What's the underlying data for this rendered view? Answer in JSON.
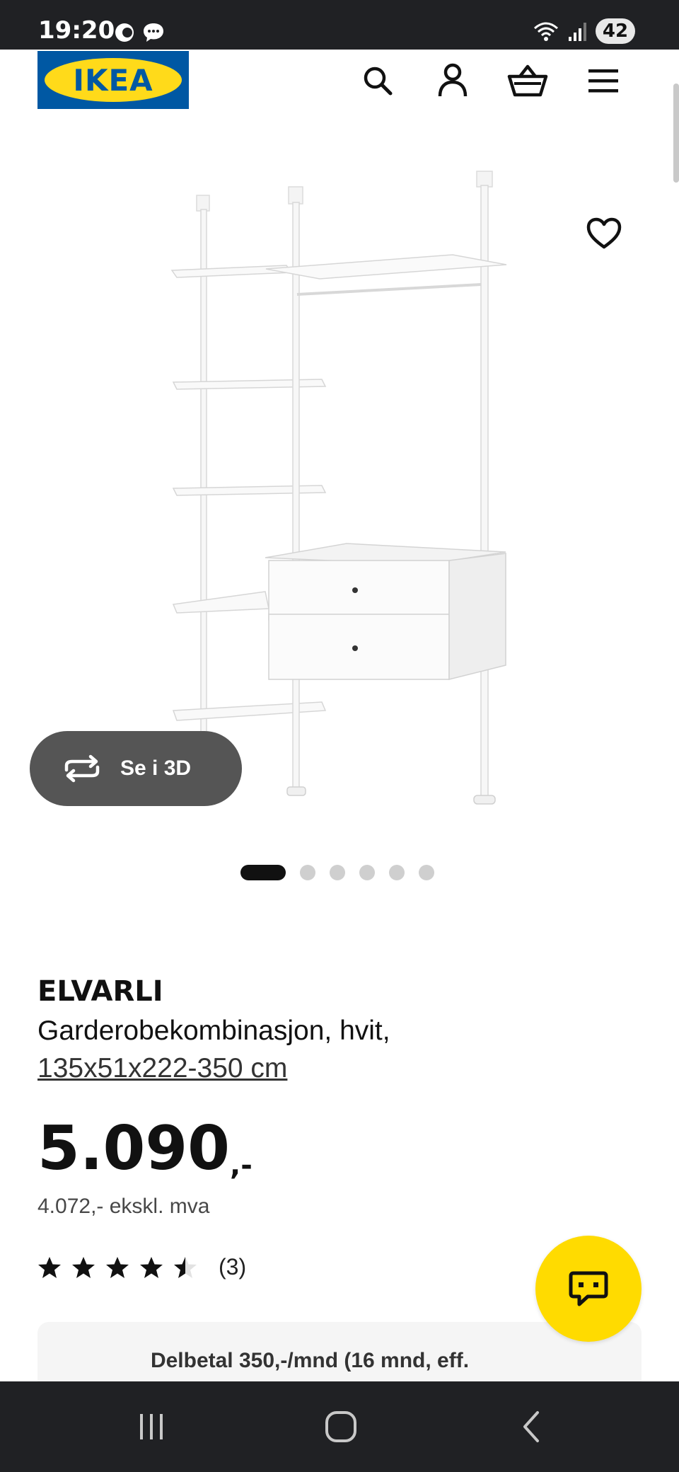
{
  "status_bar": {
    "time": "19:20",
    "battery": "42",
    "icons": [
      "do-not-disturb-icon",
      "chat-bubble-icon",
      "wifi-icon",
      "signal-icon",
      "battery-icon"
    ]
  },
  "header": {
    "logo_text": "IKEA",
    "icons": [
      "search-icon",
      "account-icon",
      "basket-icon",
      "menu-icon"
    ]
  },
  "gallery": {
    "view_3d_label": "Se i 3D",
    "slides": 6,
    "active_slide": 1
  },
  "product": {
    "name": "ELVARLI",
    "description": "Garderobekombinasjon, hvit,",
    "measure": "135x51x222-350 cm",
    "price": "5.090",
    "price_suffix": ",-",
    "price_ex_vat": "4.072,- ekskl. mva",
    "rating_value": 4.5,
    "rating_max": 5,
    "rating_count": "(3)"
  },
  "installment": {
    "text": "Delbetal 350,-/mnd (16 mnd, eff."
  },
  "colors": {
    "ikea_blue": "#0058a3",
    "ikea_yellow": "#ffda1a",
    "chat_yellow": "#ffdb00",
    "system_bar": "#202124"
  }
}
